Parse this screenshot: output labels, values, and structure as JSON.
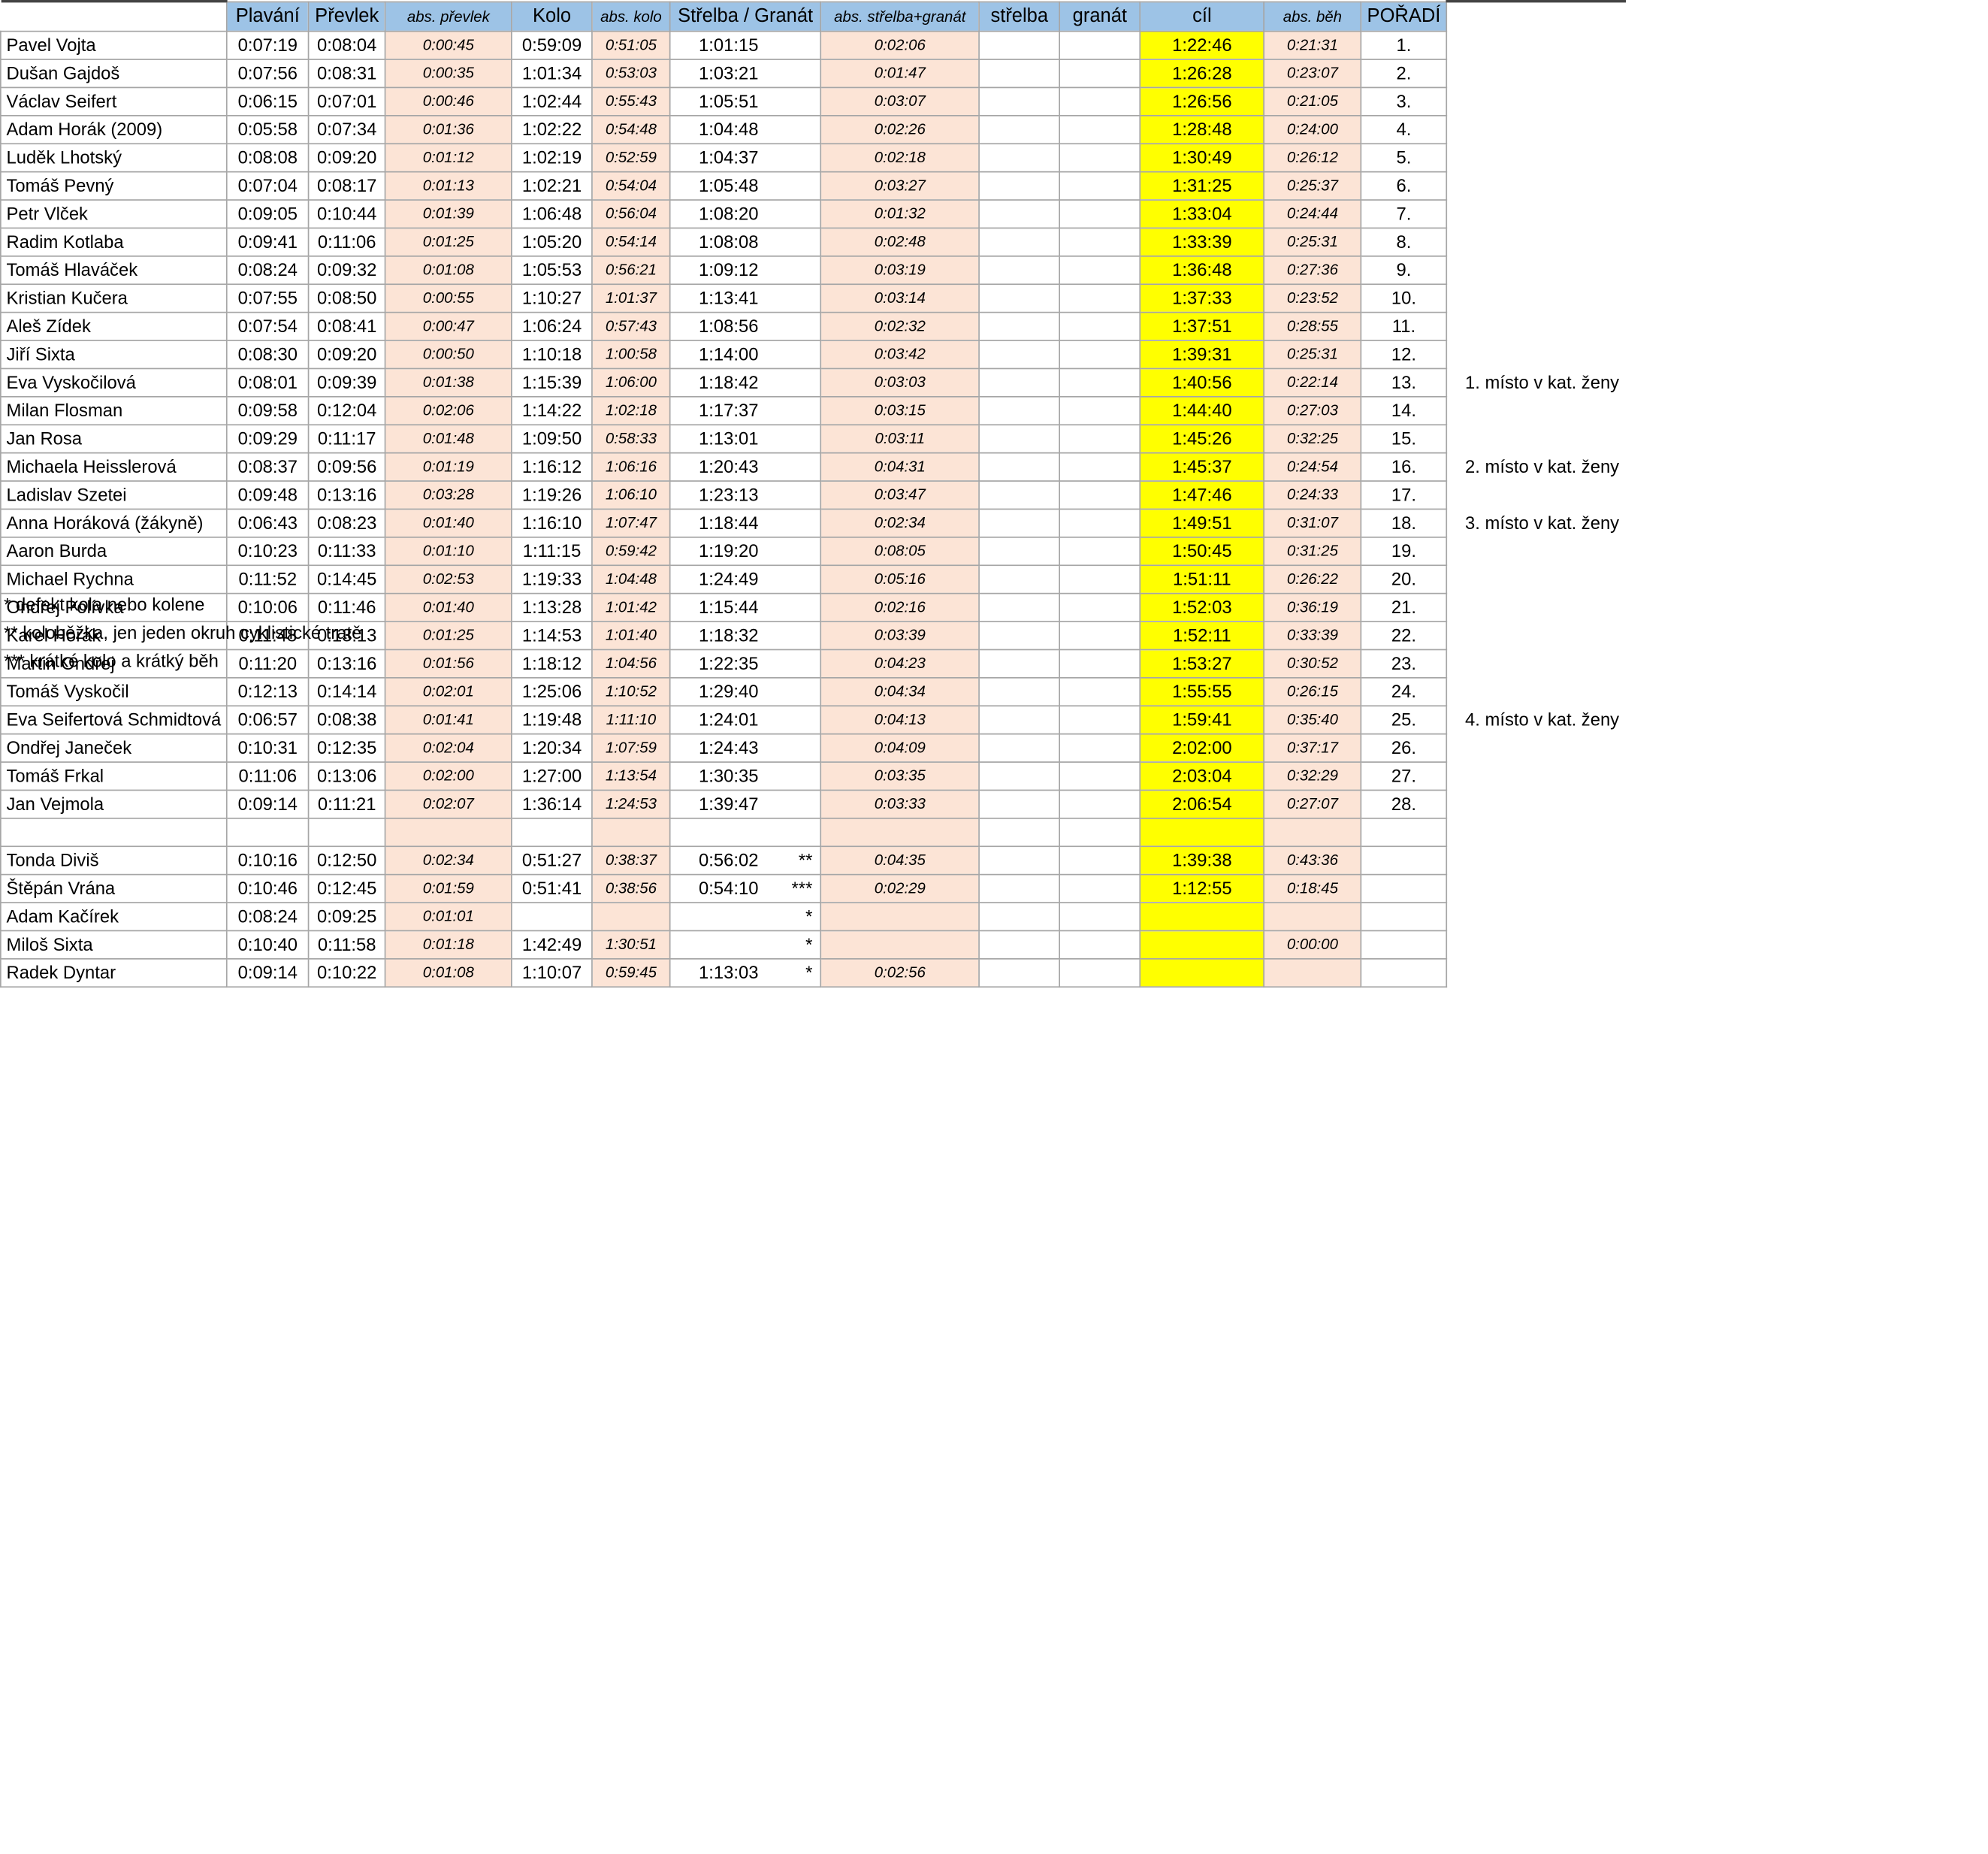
{
  "headers": [
    "",
    "Plavání",
    "Převlek",
    "abs. převlek",
    "Kolo",
    "abs. kolo",
    "Střelba / Granát",
    "abs. střelba+granát",
    "střelba",
    "granát",
    "cíl",
    "abs. běh",
    "POŘADÍ"
  ],
  "rows": [
    {
      "name": "Pavel Vojta",
      "swim": "0:07:19",
      "t1": "0:08:04",
      "abs_t1": "0:00:45",
      "bike": "0:59:09",
      "abs_bike": "0:51:05",
      "shoot": "1:01:15",
      "mark": "",
      "abs_shoot": "0:02:06",
      "goal": "1:22:46",
      "abs_run": "0:21:31",
      "rank": "1.",
      "note": ""
    },
    {
      "name": "Dušan Gajdoš",
      "swim": "0:07:56",
      "t1": "0:08:31",
      "abs_t1": "0:00:35",
      "bike": "1:01:34",
      "abs_bike": "0:53:03",
      "shoot": "1:03:21",
      "mark": "",
      "abs_shoot": "0:01:47",
      "goal": "1:26:28",
      "abs_run": "0:23:07",
      "rank": "2.",
      "note": ""
    },
    {
      "name": "Václav Seifert",
      "swim": "0:06:15",
      "t1": "0:07:01",
      "abs_t1": "0:00:46",
      "bike": "1:02:44",
      "abs_bike": "0:55:43",
      "shoot": "1:05:51",
      "mark": "",
      "abs_shoot": "0:03:07",
      "goal": "1:26:56",
      "abs_run": "0:21:05",
      "rank": "3.",
      "note": ""
    },
    {
      "name": "Adam Horák (2009)",
      "swim": "0:05:58",
      "t1": "0:07:34",
      "abs_t1": "0:01:36",
      "bike": "1:02:22",
      "abs_bike": "0:54:48",
      "shoot": "1:04:48",
      "mark": "",
      "abs_shoot": "0:02:26",
      "goal": "1:28:48",
      "abs_run": "0:24:00",
      "rank": "4.",
      "note": ""
    },
    {
      "name": "Luděk Lhotský",
      "swim": "0:08:08",
      "t1": "0:09:20",
      "abs_t1": "0:01:12",
      "bike": "1:02:19",
      "abs_bike": "0:52:59",
      "shoot": "1:04:37",
      "mark": "",
      "abs_shoot": "0:02:18",
      "goal": "1:30:49",
      "abs_run": "0:26:12",
      "rank": "5.",
      "note": ""
    },
    {
      "name": "Tomáš Pevný",
      "swim": "0:07:04",
      "t1": "0:08:17",
      "abs_t1": "0:01:13",
      "bike": "1:02:21",
      "abs_bike": "0:54:04",
      "shoot": "1:05:48",
      "mark": "",
      "abs_shoot": "0:03:27",
      "goal": "1:31:25",
      "abs_run": "0:25:37",
      "rank": "6.",
      "note": ""
    },
    {
      "name": "Petr Vlček",
      "swim": "0:09:05",
      "t1": "0:10:44",
      "abs_t1": "0:01:39",
      "bike": "1:06:48",
      "abs_bike": "0:56:04",
      "shoot": "1:08:20",
      "mark": "",
      "abs_shoot": "0:01:32",
      "goal": "1:33:04",
      "abs_run": "0:24:44",
      "rank": "7.",
      "note": ""
    },
    {
      "name": "Radim Kotlaba",
      "swim": "0:09:41",
      "t1": "0:11:06",
      "abs_t1": "0:01:25",
      "bike": "1:05:20",
      "abs_bike": "0:54:14",
      "shoot": "1:08:08",
      "mark": "",
      "abs_shoot": "0:02:48",
      "goal": "1:33:39",
      "abs_run": "0:25:31",
      "rank": "8.",
      "note": ""
    },
    {
      "name": "Tomáš Hlaváček",
      "swim": "0:08:24",
      "t1": "0:09:32",
      "abs_t1": "0:01:08",
      "bike": "1:05:53",
      "abs_bike": "0:56:21",
      "shoot": "1:09:12",
      "mark": "",
      "abs_shoot": "0:03:19",
      "goal": "1:36:48",
      "abs_run": "0:27:36",
      "rank": "9.",
      "note": ""
    },
    {
      "name": "Kristian Kučera",
      "swim": "0:07:55",
      "t1": "0:08:50",
      "abs_t1": "0:00:55",
      "bike": "1:10:27",
      "abs_bike": "1:01:37",
      "shoot": "1:13:41",
      "mark": "",
      "abs_shoot": "0:03:14",
      "goal": "1:37:33",
      "abs_run": "0:23:52",
      "rank": "10.",
      "note": ""
    },
    {
      "name": "Aleš Zídek",
      "swim": "0:07:54",
      "t1": "0:08:41",
      "abs_t1": "0:00:47",
      "bike": "1:06:24",
      "abs_bike": "0:57:43",
      "shoot": "1:08:56",
      "mark": "",
      "abs_shoot": "0:02:32",
      "goal": "1:37:51",
      "abs_run": "0:28:55",
      "rank": "11.",
      "note": ""
    },
    {
      "name": "Jiří Sixta",
      "swim": "0:08:30",
      "t1": "0:09:20",
      "abs_t1": "0:00:50",
      "bike": "1:10:18",
      "abs_bike": "1:00:58",
      "shoot": "1:14:00",
      "mark": "",
      "abs_shoot": "0:03:42",
      "goal": "1:39:31",
      "abs_run": "0:25:31",
      "rank": "12.",
      "note": ""
    },
    {
      "name": "Eva Vyskočilová",
      "swim": "0:08:01",
      "t1": "0:09:39",
      "abs_t1": "0:01:38",
      "bike": "1:15:39",
      "abs_bike": "1:06:00",
      "shoot": "1:18:42",
      "mark": "",
      "abs_shoot": "0:03:03",
      "goal": "1:40:56",
      "abs_run": "0:22:14",
      "rank": "13.",
      "note": "1. místo v kat. ženy"
    },
    {
      "name": "Milan Flosman",
      "swim": "0:09:58",
      "t1": "0:12:04",
      "abs_t1": "0:02:06",
      "bike": "1:14:22",
      "abs_bike": "1:02:18",
      "shoot": "1:17:37",
      "mark": "",
      "abs_shoot": "0:03:15",
      "goal": "1:44:40",
      "abs_run": "0:27:03",
      "rank": "14.",
      "note": ""
    },
    {
      "name": "Jan Rosa",
      "swim": "0:09:29",
      "t1": "0:11:17",
      "abs_t1": "0:01:48",
      "bike": "1:09:50",
      "abs_bike": "0:58:33",
      "shoot": "1:13:01",
      "mark": "",
      "abs_shoot": "0:03:11",
      "goal": "1:45:26",
      "abs_run": "0:32:25",
      "rank": "15.",
      "note": ""
    },
    {
      "name": "Michaela Heisslerová",
      "swim": "0:08:37",
      "t1": "0:09:56",
      "abs_t1": "0:01:19",
      "bike": "1:16:12",
      "abs_bike": "1:06:16",
      "shoot": "1:20:43",
      "mark": "",
      "abs_shoot": "0:04:31",
      "goal": "1:45:37",
      "abs_run": "0:24:54",
      "rank": "16.",
      "note": "2. místo v kat. ženy"
    },
    {
      "name": "Ladislav Szetei",
      "swim": "0:09:48",
      "t1": "0:13:16",
      "abs_t1": "0:03:28",
      "bike": "1:19:26",
      "abs_bike": "1:06:10",
      "shoot": "1:23:13",
      "mark": "",
      "abs_shoot": "0:03:47",
      "goal": "1:47:46",
      "abs_run": "0:24:33",
      "rank": "17.",
      "note": ""
    },
    {
      "name": "Anna Horáková (žákyně)",
      "swim": "0:06:43",
      "t1": "0:08:23",
      "abs_t1": "0:01:40",
      "bike": "1:16:10",
      "abs_bike": "1:07:47",
      "shoot": "1:18:44",
      "mark": "",
      "abs_shoot": "0:02:34",
      "goal": "1:49:51",
      "abs_run": "0:31:07",
      "rank": "18.",
      "note": "3. místo v kat. ženy"
    },
    {
      "name": "Aaron Burda",
      "swim": "0:10:23",
      "t1": "0:11:33",
      "abs_t1": "0:01:10",
      "bike": "1:11:15",
      "abs_bike": "0:59:42",
      "shoot": "1:19:20",
      "mark": "",
      "abs_shoot": "0:08:05",
      "goal": "1:50:45",
      "abs_run": "0:31:25",
      "rank": "19.",
      "note": ""
    },
    {
      "name": "Michael Rychna",
      "swim": "0:11:52",
      "t1": "0:14:45",
      "abs_t1": "0:02:53",
      "bike": "1:19:33",
      "abs_bike": "1:04:48",
      "shoot": "1:24:49",
      "mark": "",
      "abs_shoot": "0:05:16",
      "goal": "1:51:11",
      "abs_run": "0:26:22",
      "rank": "20.",
      "note": ""
    },
    {
      "name": "Ondřej Polívka",
      "swim": "0:10:06",
      "t1": "0:11:46",
      "abs_t1": "0:01:40",
      "bike": "1:13:28",
      "abs_bike": "1:01:42",
      "shoot": "1:15:44",
      "mark": "",
      "abs_shoot": "0:02:16",
      "goal": "1:52:03",
      "abs_run": "0:36:19",
      "rank": "21.",
      "note": ""
    },
    {
      "name": "Karel Horák",
      "swim": "0:11:48",
      "t1": "0:13:13",
      "abs_t1": "0:01:25",
      "bike": "1:14:53",
      "abs_bike": "1:01:40",
      "shoot": "1:18:32",
      "mark": "",
      "abs_shoot": "0:03:39",
      "goal": "1:52:11",
      "abs_run": "0:33:39",
      "rank": "22.",
      "note": ""
    },
    {
      "name": "Martin Ondřej",
      "swim": "0:11:20",
      "t1": "0:13:16",
      "abs_t1": "0:01:56",
      "bike": "1:18:12",
      "abs_bike": "1:04:56",
      "shoot": "1:22:35",
      "mark": "",
      "abs_shoot": "0:04:23",
      "goal": "1:53:27",
      "abs_run": "0:30:52",
      "rank": "23.",
      "note": ""
    },
    {
      "name": "Tomáš Vyskočil",
      "swim": "0:12:13",
      "t1": "0:14:14",
      "abs_t1": "0:02:01",
      "bike": "1:25:06",
      "abs_bike": "1:10:52",
      "shoot": "1:29:40",
      "mark": "",
      "abs_shoot": "0:04:34",
      "goal": "1:55:55",
      "abs_run": "0:26:15",
      "rank": "24.",
      "note": ""
    },
    {
      "name": "Eva Seifertová Schmidtová",
      "swim": "0:06:57",
      "t1": "0:08:38",
      "abs_t1": "0:01:41",
      "bike": "1:19:48",
      "abs_bike": "1:11:10",
      "shoot": "1:24:01",
      "mark": "",
      "abs_shoot": "0:04:13",
      "goal": "1:59:41",
      "abs_run": "0:35:40",
      "rank": "25.",
      "note": "4. místo v kat. ženy"
    },
    {
      "name": "Ondřej Janeček",
      "swim": "0:10:31",
      "t1": "0:12:35",
      "abs_t1": "0:02:04",
      "bike": "1:20:34",
      "abs_bike": "1:07:59",
      "shoot": "1:24:43",
      "mark": "",
      "abs_shoot": "0:04:09",
      "goal": "2:02:00",
      "abs_run": "0:37:17",
      "rank": "26.",
      "note": ""
    },
    {
      "name": "Tomáš Frkal",
      "swim": "0:11:06",
      "t1": "0:13:06",
      "abs_t1": "0:02:00",
      "bike": "1:27:00",
      "abs_bike": "1:13:54",
      "shoot": "1:30:35",
      "mark": "",
      "abs_shoot": "0:03:35",
      "goal": "2:03:04",
      "abs_run": "0:32:29",
      "rank": "27.",
      "note": ""
    },
    {
      "name": "Jan Vejmola",
      "swim": "0:09:14",
      "t1": "0:11:21",
      "abs_t1": "0:02:07",
      "bike": "1:36:14",
      "abs_bike": "1:24:53",
      "shoot": "1:39:47",
      "mark": "",
      "abs_shoot": "0:03:33",
      "goal": "2:06:54",
      "abs_run": "0:27:07",
      "rank": "28.",
      "note": ""
    },
    {
      "gap": true
    },
    {
      "name": "Tonda Diviš",
      "swim": "0:10:16",
      "t1": "0:12:50",
      "abs_t1": "0:02:34",
      "bike": "0:51:27",
      "abs_bike": "0:38:37",
      "shoot": "0:56:02",
      "mark": "**",
      "abs_shoot": "0:04:35",
      "goal": "1:39:38",
      "abs_run": "0:43:36",
      "rank": "",
      "note": ""
    },
    {
      "name": "Štěpán Vrána",
      "swim": "0:10:46",
      "t1": "0:12:45",
      "abs_t1": "0:01:59",
      "bike": "0:51:41",
      "abs_bike": "0:38:56",
      "shoot": "0:54:10",
      "mark": "***",
      "abs_shoot": "0:02:29",
      "goal": "1:12:55",
      "abs_run": "0:18:45",
      "rank": "",
      "note": ""
    },
    {
      "name": "Adam Kačírek",
      "swim": "0:08:24",
      "t1": "0:09:25",
      "abs_t1": "0:01:01",
      "bike": "",
      "abs_bike": "",
      "shoot": "",
      "mark": "*",
      "abs_shoot": "",
      "goal": "",
      "abs_run": "",
      "rank": "",
      "note": ""
    },
    {
      "name": "Miloš Sixta",
      "swim": "0:10:40",
      "t1": "0:11:58",
      "abs_t1": "0:01:18",
      "bike": "1:42:49",
      "abs_bike": "1:30:51",
      "shoot": "",
      "mark": "*",
      "abs_shoot": "",
      "goal": "",
      "abs_run": "0:00:00",
      "rank": "",
      "note": ""
    },
    {
      "name": "Radek Dyntar",
      "swim": "0:09:14",
      "t1": "0:10:22",
      "abs_t1": "0:01:08",
      "bike": "1:10:07",
      "abs_bike": "0:59:45",
      "shoot": "1:13:03",
      "mark": "*",
      "abs_shoot": "0:02:56",
      "goal": "",
      "abs_run": "",
      "rank": "",
      "note": ""
    }
  ],
  "footnotes": [
    "* defekt kola nebo kolene",
    "** koloběžka, jen jeden okruh cyklistické tratě",
    "*** krátké kolo a krátký běh"
  ]
}
